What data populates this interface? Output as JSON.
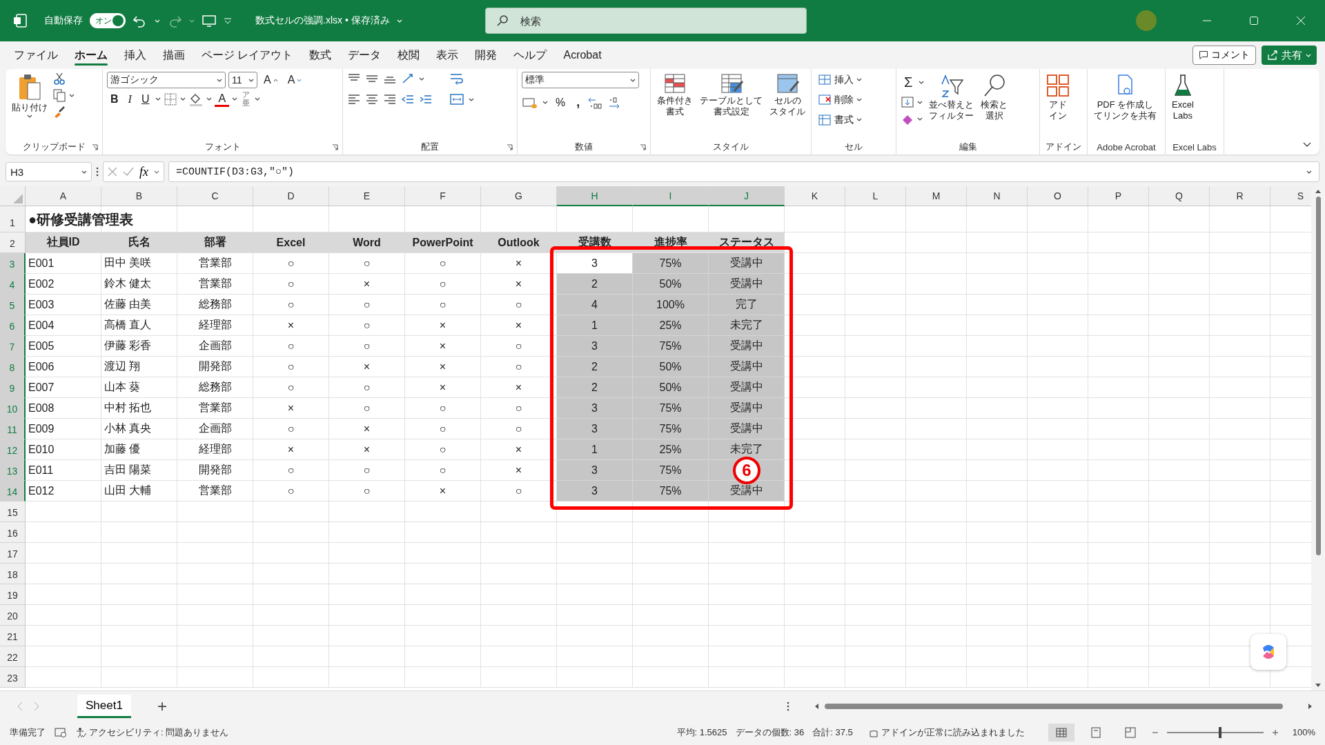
{
  "title_bar": {
    "autosave_label": "自動保存",
    "autosave_on": true,
    "toggle_label": "オン",
    "document_title": "数式セルの強調.xlsx • 保存済み",
    "search_placeholder": "検索"
  },
  "menu_tabs": [
    {
      "label": "ファイル",
      "selected": false
    },
    {
      "label": "ホーム",
      "selected": true
    },
    {
      "label": "挿入",
      "selected": false
    },
    {
      "label": "描画",
      "selected": false
    },
    {
      "label": "ページ レイアウト",
      "selected": false
    },
    {
      "label": "数式",
      "selected": false
    },
    {
      "label": "データ",
      "selected": false
    },
    {
      "label": "校閲",
      "selected": false
    },
    {
      "label": "表示",
      "selected": false
    },
    {
      "label": "開発",
      "selected": false
    },
    {
      "label": "ヘルプ",
      "selected": false
    },
    {
      "label": "Acrobat",
      "selected": false
    }
  ],
  "comment_button": "コメント",
  "share_button": "共有",
  "ribbon": [
    {
      "kind": "clipboard",
      "label": "クリップボード",
      "buttons": [
        "貼り付け"
      ]
    },
    {
      "kind": "font",
      "label": "フォント",
      "font_name": "游ゴシック",
      "font_size": "11",
      "glyphs": [
        "A",
        "A",
        "B",
        "I",
        "U",
        "A",
        "ア",
        "亜"
      ]
    },
    {
      "kind": "alignment",
      "label": "配置"
    },
    {
      "kind": "number",
      "label": "数値",
      "format": "標準",
      "glyphs": [
        "%",
        ","
      ]
    },
    {
      "kind": "styles",
      "label": "スタイル",
      "buttons": [
        {
          "lines": [
            "条件付き",
            "書式"
          ]
        },
        {
          "lines": [
            "テーブルとして",
            "書式設定"
          ]
        },
        {
          "lines": [
            "セルの",
            "スタイル"
          ]
        }
      ]
    },
    {
      "kind": "cells",
      "label": "セル",
      "buttons": [
        "挿入",
        "削除",
        "書式"
      ]
    },
    {
      "kind": "editing",
      "label": "編集",
      "glyphs": [
        "Σ"
      ],
      "buttons": [
        {
          "lines": [
            "並べ替えと",
            "フィルター"
          ]
        },
        {
          "lines": [
            "検索と",
            "選択"
          ]
        }
      ]
    },
    {
      "kind": "addins",
      "label": "アドイン",
      "buttons": [
        {
          "lines": [
            "アド",
            "イン"
          ]
        }
      ]
    },
    {
      "kind": "acrobat",
      "label": "Adobe Acrobat",
      "buttons": [
        {
          "lines": [
            "PDF を作成し",
            "てリンクを共有"
          ]
        }
      ]
    },
    {
      "kind": "labs",
      "label": "Excel Labs",
      "buttons": [
        {
          "lines": [
            "Excel",
            "Labs"
          ]
        }
      ]
    }
  ],
  "formula_bar": {
    "name_box": "H3",
    "fx": "fx",
    "formula": "=COUNTIF(D3:G3,\"○\")"
  },
  "columns": [
    {
      "name": "A",
      "selected": false
    },
    {
      "name": "B",
      "selected": false
    },
    {
      "name": "C",
      "selected": false
    },
    {
      "name": "D",
      "selected": false
    },
    {
      "name": "E",
      "selected": false
    },
    {
      "name": "F",
      "selected": false
    },
    {
      "name": "G",
      "selected": false
    },
    {
      "name": "H",
      "selected": true
    },
    {
      "name": "I",
      "selected": true
    },
    {
      "name": "J",
      "selected": true
    },
    {
      "name": "K",
      "selected": false
    },
    {
      "name": "L",
      "selected": false
    },
    {
      "name": "M",
      "selected": false
    },
    {
      "name": "N",
      "selected": false
    },
    {
      "name": "O",
      "selected": false
    },
    {
      "name": "P",
      "selected": false
    },
    {
      "name": "Q",
      "selected": false
    },
    {
      "name": "R",
      "selected": false
    },
    {
      "name": "S",
      "selected": false
    }
  ],
  "rows": [
    {
      "number": "1",
      "kind": "title",
      "selected": false,
      "cells": [
        "●研修受講管理表"
      ]
    },
    {
      "number": "2",
      "kind": "header",
      "selected": false,
      "cells": [
        "社員ID",
        "氏名",
        "部署",
        "Excel",
        "Word",
        "PowerPoint",
        "Outlook",
        "受講数",
        "進捗率",
        "ステータス"
      ]
    },
    {
      "number": "3",
      "kind": "data",
      "selected": true,
      "cells": [
        "E001",
        "田中 美咲",
        "営業部",
        "○",
        "○",
        "○",
        "×",
        "3",
        "75%",
        "受講中"
      ]
    },
    {
      "number": "4",
      "kind": "data",
      "selected": true,
      "cells": [
        "E002",
        "鈴木 健太",
        "営業部",
        "○",
        "×",
        "○",
        "×",
        "2",
        "50%",
        "受講中"
      ]
    },
    {
      "number": "5",
      "kind": "data",
      "selected": true,
      "cells": [
        "E003",
        "佐藤 由美",
        "総務部",
        "○",
        "○",
        "○",
        "○",
        "4",
        "100%",
        "完了"
      ]
    },
    {
      "number": "6",
      "kind": "data",
      "selected": true,
      "cells": [
        "E004",
        "高橋 直人",
        "経理部",
        "×",
        "○",
        "×",
        "×",
        "1",
        "25%",
        "未完了"
      ]
    },
    {
      "number": "7",
      "kind": "data",
      "selected": true,
      "cells": [
        "E005",
        "伊藤 彩香",
        "企画部",
        "○",
        "○",
        "×",
        "○",
        "3",
        "75%",
        "受講中"
      ]
    },
    {
      "number": "8",
      "kind": "data",
      "selected": true,
      "cells": [
        "E006",
        "渡辺 翔",
        "開発部",
        "○",
        "×",
        "×",
        "○",
        "2",
        "50%",
        "受講中"
      ]
    },
    {
      "number": "9",
      "kind": "data",
      "selected": true,
      "cells": [
        "E007",
        "山本 葵",
        "総務部",
        "○",
        "○",
        "×",
        "×",
        "2",
        "50%",
        "受講中"
      ]
    },
    {
      "number": "10",
      "kind": "data",
      "selected": true,
      "cells": [
        "E008",
        "中村 拓也",
        "営業部",
        "×",
        "○",
        "○",
        "○",
        "3",
        "75%",
        "受講中"
      ]
    },
    {
      "number": "11",
      "kind": "data",
      "selected": true,
      "cells": [
        "E009",
        "小林 真央",
        "企画部",
        "○",
        "×",
        "○",
        "○",
        "3",
        "75%",
        "受講中"
      ]
    },
    {
      "number": "12",
      "kind": "data",
      "selected": true,
      "cells": [
        "E010",
        "加藤 優",
        "経理部",
        "×",
        "×",
        "○",
        "×",
        "1",
        "25%",
        "未完了"
      ]
    },
    {
      "number": "13",
      "kind": "data",
      "selected": true,
      "cells": [
        "E011",
        "吉田 陽菜",
        "開発部",
        "○",
        "○",
        "○",
        "×",
        "3",
        "75%"
      ]
    },
    {
      "number": "14",
      "kind": "data",
      "selected": true,
      "cells": [
        "E012",
        "山田 大輔",
        "営業部",
        "○",
        "○",
        "×",
        "○",
        "3",
        "75%",
        "受講中"
      ]
    },
    {
      "number": "15",
      "selected": false
    },
    {
      "number": "16",
      "selected": false
    },
    {
      "number": "17",
      "selected": false
    },
    {
      "number": "18",
      "selected": false
    },
    {
      "number": "19",
      "selected": false
    },
    {
      "number": "20",
      "selected": false
    },
    {
      "number": "21",
      "selected": false
    },
    {
      "number": "22",
      "selected": false
    },
    {
      "number": "23",
      "selected": false
    }
  ],
  "annotation": {
    "badge": "6"
  },
  "sheet_tabs": [
    {
      "label": "Sheet1",
      "selected": true
    }
  ],
  "add_sheet": "+",
  "status_bar": {
    "ready": "準備完了",
    "accessibility": "アクセシビリティ: 問題ありません",
    "average": "平均: 1.5625",
    "count": "データの個数: 36",
    "sum": "合計: 37.5",
    "addin_status": "アドインが正常に読み込まれました",
    "zoom": "100%",
    "zoom_slider": {
      "level": 0.55
    }
  }
}
